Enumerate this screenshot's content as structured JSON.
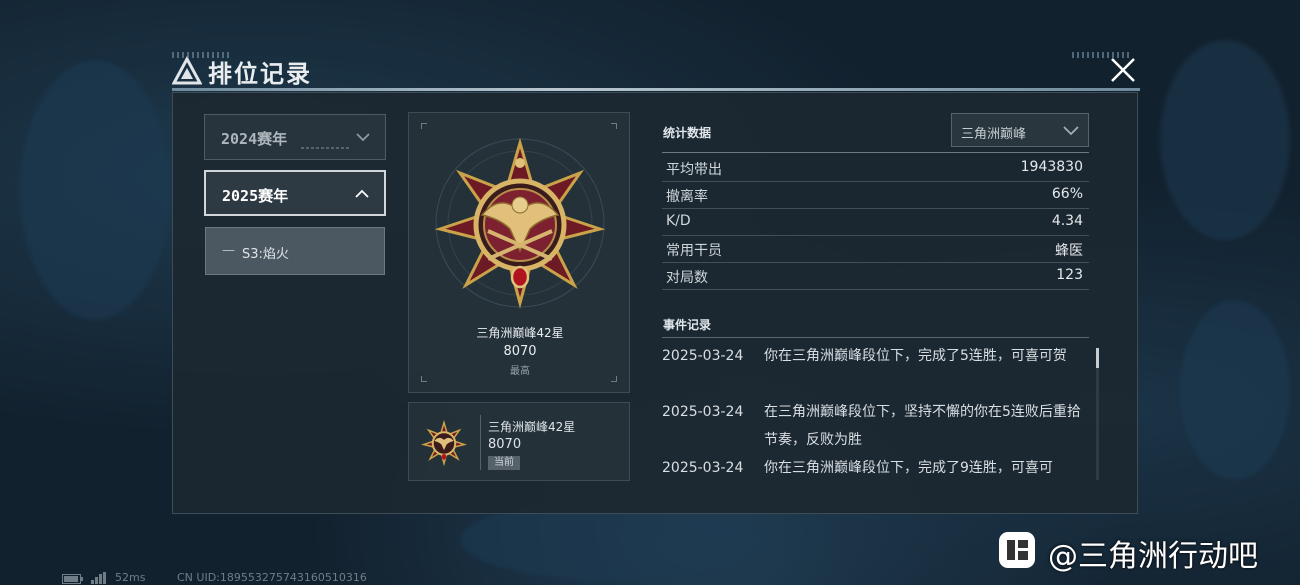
{
  "window": {
    "title": "排位记录"
  },
  "seasons": [
    {
      "label": "2024赛年",
      "expanded": false
    },
    {
      "label": "2025赛年",
      "expanded": true
    }
  ],
  "sub_season": {
    "dash": "—",
    "label": "S3:焰火"
  },
  "best_rank": {
    "name": "三角洲巅峰42星",
    "score": "8070",
    "tag": "最高"
  },
  "current_rank": {
    "name": "三角洲巅峰42星",
    "score": "8070",
    "badge": "当前"
  },
  "stats": {
    "title": "统计数据",
    "mode_selected": "三角洲巅峰",
    "rows": [
      {
        "key": "平均带出",
        "value": "1943830"
      },
      {
        "key": "撤离率",
        "value": "66%"
      },
      {
        "key": "K/D",
        "value": "4.34"
      },
      {
        "key": "常用干员",
        "value": "蜂医"
      },
      {
        "key": "对局数",
        "value": "123"
      }
    ]
  },
  "events": {
    "title": "事件记录",
    "items": [
      {
        "date": "2025-03-24",
        "text": "你在三角洲巅峰段位下，完成了5连胜，可喜可贺"
      },
      {
        "date": "2025-03-24",
        "text": "在三角洲巅峰段位下，坚持不懈的你在5连败后重拾节奏，反败为胜"
      },
      {
        "date": "2025-03-24",
        "text": "你在三角洲巅峰段位下，完成了9连胜，可喜可"
      }
    ]
  },
  "watermark": {
    "text": "@三角洲行动吧"
  },
  "status_bar": {
    "ping": "52ms",
    "uid": "CN UID:189553275743160510316"
  },
  "colors": {
    "panel_bg": "#1c2830",
    "accent_gold": "#c9a24a",
    "accent_red": "#7a1a26"
  },
  "icons": [
    "game-logo-icon",
    "close-icon",
    "chevron-down-icon",
    "chevron-up-icon",
    "medal-icon",
    "tieba-icon",
    "battery-icon",
    "signal-icon"
  ]
}
